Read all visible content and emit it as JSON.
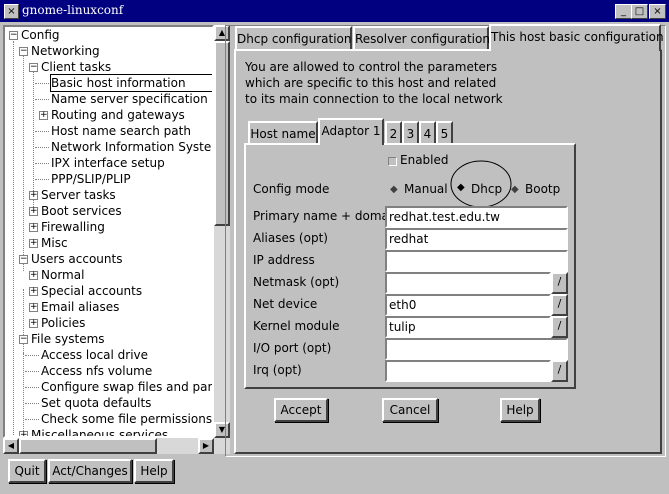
{
  "window": {
    "title": "gnome-linuxconf",
    "menu_icon": "×",
    "min": "_",
    "max": "□",
    "close": "×"
  },
  "tree": [
    {
      "label": "Config",
      "exp": "−"
    },
    {
      "label": "Networking",
      "exp": "−"
    },
    {
      "label": "Client tasks",
      "exp": "−"
    },
    {
      "label": "Basic host information"
    },
    {
      "label": "Name server specification (DNS)"
    },
    {
      "label": "Routing and gateways",
      "exp": "+"
    },
    {
      "label": "Host name search path"
    },
    {
      "label": "Network Information System (NIS)"
    },
    {
      "label": "IPX interface setup"
    },
    {
      "label": "PPP/SLIP/PLIP"
    },
    {
      "label": "Server tasks",
      "exp": "+"
    },
    {
      "label": "Boot services",
      "exp": "+"
    },
    {
      "label": "Firewalling",
      "exp": "+"
    },
    {
      "label": "Misc",
      "exp": "+"
    },
    {
      "label": "Users accounts",
      "exp": "−"
    },
    {
      "label": "Normal",
      "exp": "+"
    },
    {
      "label": "Special accounts",
      "exp": "+"
    },
    {
      "label": "Email aliases",
      "exp": "+"
    },
    {
      "label": "Policies",
      "exp": "+"
    },
    {
      "label": "File systems",
      "exp": "−"
    },
    {
      "label": "Access local drive"
    },
    {
      "label": "Access nfs volume"
    },
    {
      "label": "Configure swap files and partitions"
    },
    {
      "label": "Set quota defaults"
    },
    {
      "label": "Check some file permissions"
    },
    {
      "label": "Miscellaneous services",
      "exp": "+"
    }
  ],
  "bottom_buttons": {
    "quit": "Quit",
    "act": "Act/Changes",
    "help": "Help"
  },
  "tabs": [
    "Dhcp configuration",
    "Resolver configuration",
    "This host basic configuration"
  ],
  "intro": [
    "You are allowed to control the parameters",
    "which are specific to this host and related",
    "to its main connection to the local network"
  ],
  "subtabs": [
    "Host name",
    "Adaptor 1",
    "2",
    "3",
    "4",
    "5"
  ],
  "form": {
    "enabled": "Enabled",
    "config_mode": "Config mode",
    "modes": [
      "Manual",
      "Dhcp",
      "Bootp"
    ],
    "primary_label": "Primary name + domain",
    "primary_value": "redhat.test.edu.tw",
    "aliases_label": "Aliases (opt)",
    "aliases_value": "redhat",
    "ip_label": "IP address",
    "ip_value": "",
    "netmask_label": "Netmask (opt)",
    "netmask_value": "",
    "netdev_label": "Net device",
    "netdev_value": "eth0",
    "kmod_label": "Kernel module",
    "kmod_value": "tulip",
    "io_label": "I/O port (opt)",
    "io_value": "",
    "irq_label": "Irq (opt)",
    "irq_value": "",
    "combo_glyph": "/"
  },
  "actions": {
    "accept": "Accept",
    "cancel": "Cancel",
    "help": "Help"
  }
}
